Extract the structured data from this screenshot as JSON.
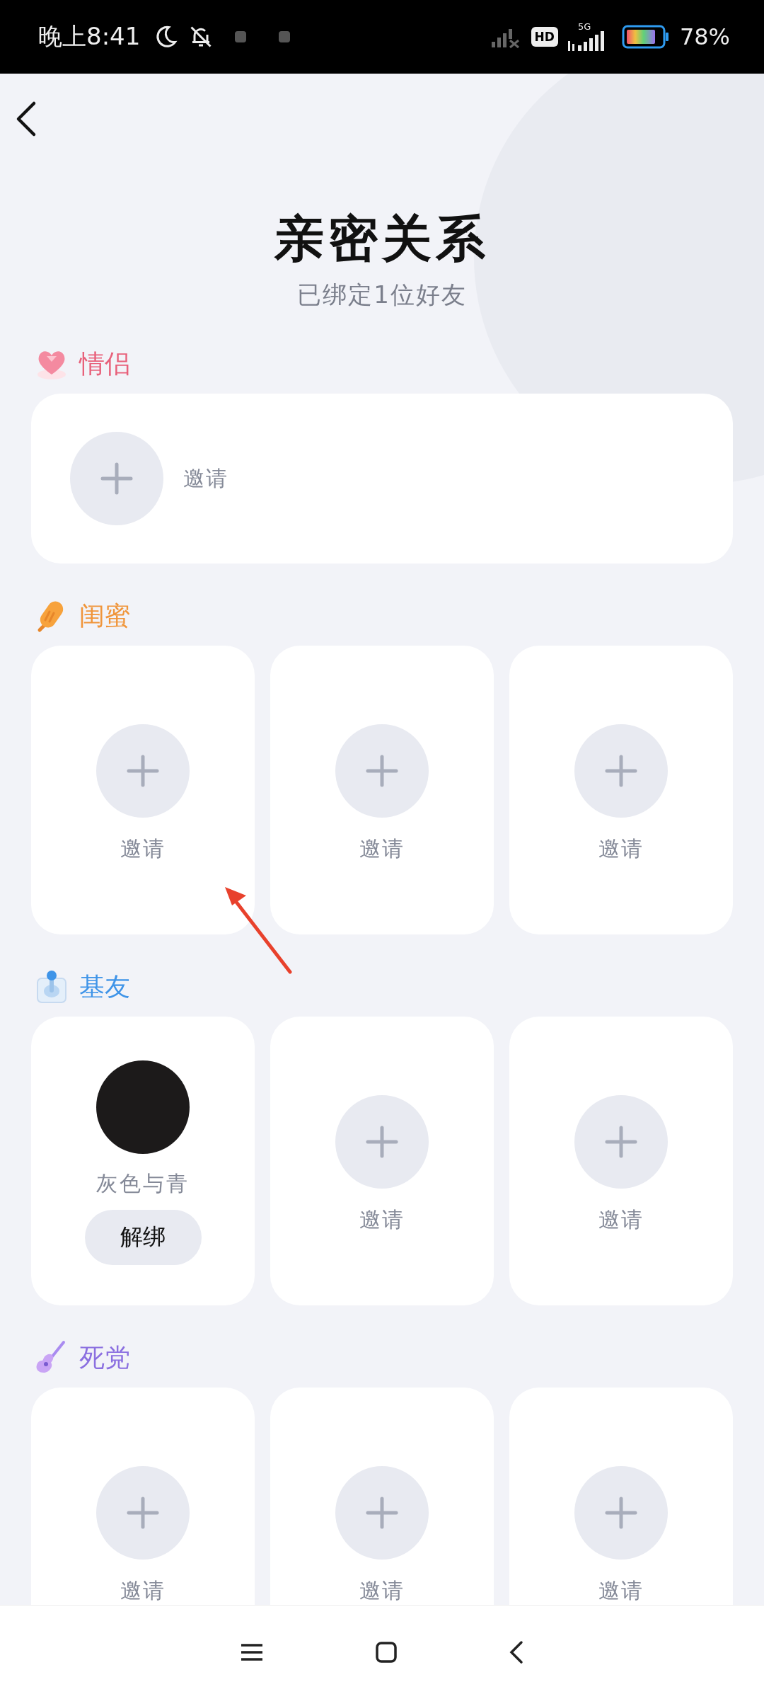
{
  "status_bar": {
    "time": "晚上8:41",
    "network": "5G",
    "hd": "HD",
    "battery": "78%"
  },
  "header": {
    "title": "亲密关系",
    "subtitle": "已绑定1位好友"
  },
  "sections": [
    {
      "title": "情侣",
      "color": "#e8607a",
      "kind": "wide",
      "slots": [
        {
          "kind": "invite",
          "label": "邀请"
        }
      ]
    },
    {
      "title": "闺蜜",
      "color": "#f0953a",
      "kind": "grid",
      "slots": [
        {
          "kind": "invite",
          "label": "邀请"
        },
        {
          "kind": "invite",
          "label": "邀请"
        },
        {
          "kind": "invite",
          "label": "邀请"
        }
      ]
    },
    {
      "title": "基友",
      "color": "#3f94e8",
      "kind": "grid",
      "slots": [
        {
          "kind": "friend",
          "name": "灰色与青",
          "button": "解绑"
        },
        {
          "kind": "invite",
          "label": "邀请"
        },
        {
          "kind": "invite",
          "label": "邀请"
        }
      ]
    },
    {
      "title": "死党",
      "color": "#8b6fe0",
      "kind": "grid",
      "slots": [
        {
          "kind": "invite",
          "label": "邀请"
        },
        {
          "kind": "invite",
          "label": "邀请"
        },
        {
          "kind": "invite",
          "label": "邀请"
        }
      ]
    }
  ]
}
